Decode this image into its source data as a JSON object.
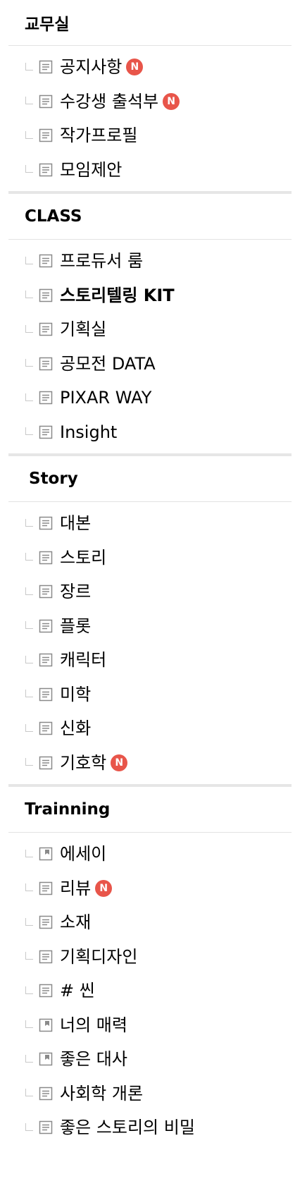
{
  "sections": [
    {
      "title": "교무실",
      "items": [
        {
          "label": "공지사항",
          "icon": "doc-lines-icon",
          "new": "N"
        },
        {
          "label": "수강생 출석부",
          "icon": "doc-lines-icon",
          "new": "N"
        },
        {
          "label": "작가프로필",
          "icon": "doc-lines-icon"
        },
        {
          "label": "모임제안",
          "icon": "doc-lines-icon"
        }
      ]
    },
    {
      "title": "CLASS",
      "items": [
        {
          "label": "프로듀서 룸",
          "icon": "doc-lines-icon"
        },
        {
          "label": "스토리텔링 KIT",
          "icon": "doc-lines-icon",
          "bold": true
        },
        {
          "label": "기획실",
          "icon": "doc-lines-icon"
        },
        {
          "label": "공모전 DATA",
          "icon": "doc-lines-icon"
        },
        {
          "label": "PIXAR WAY",
          "icon": "doc-lines-icon"
        },
        {
          "label": "Insight",
          "icon": "doc-lines-icon"
        }
      ]
    },
    {
      "title": "Story",
      "items": [
        {
          "label": "대본",
          "icon": "doc-lines-icon"
        },
        {
          "label": "스토리",
          "icon": "doc-lines-icon"
        },
        {
          "label": "장르",
          "icon": "doc-lines-icon"
        },
        {
          "label": "플롯",
          "icon": "doc-lines-icon"
        },
        {
          "label": "캐릭터",
          "icon": "doc-lines-icon"
        },
        {
          "label": "미학",
          "icon": "doc-lines-icon"
        },
        {
          "label": "신화",
          "icon": "doc-lines-icon"
        },
        {
          "label": "기호학",
          "icon": "doc-lines-icon",
          "new": "N"
        }
      ]
    },
    {
      "title": "Trainning",
      "items": [
        {
          "label": "에세이",
          "icon": "photo-board-icon"
        },
        {
          "label": "리뷰",
          "icon": "doc-lines-icon",
          "new": "N"
        },
        {
          "label": "소재",
          "icon": "doc-lines-icon"
        },
        {
          "label": "기획디자인",
          "icon": "doc-lines-icon"
        },
        {
          "label": "# 씬",
          "icon": "doc-lines-icon"
        },
        {
          "label": "너의 매력",
          "icon": "photo-board-icon"
        },
        {
          "label": "좋은 대사",
          "icon": "photo-board-icon"
        },
        {
          "label": "사회학 개론",
          "icon": "doc-lines-icon"
        },
        {
          "label": "좋은 스토리의 비밀",
          "icon": "doc-lines-icon"
        }
      ]
    }
  ],
  "colors": {
    "badge": "#e8554a",
    "divider": "#e6e6e6",
    "line": "#c9c9c9"
  }
}
